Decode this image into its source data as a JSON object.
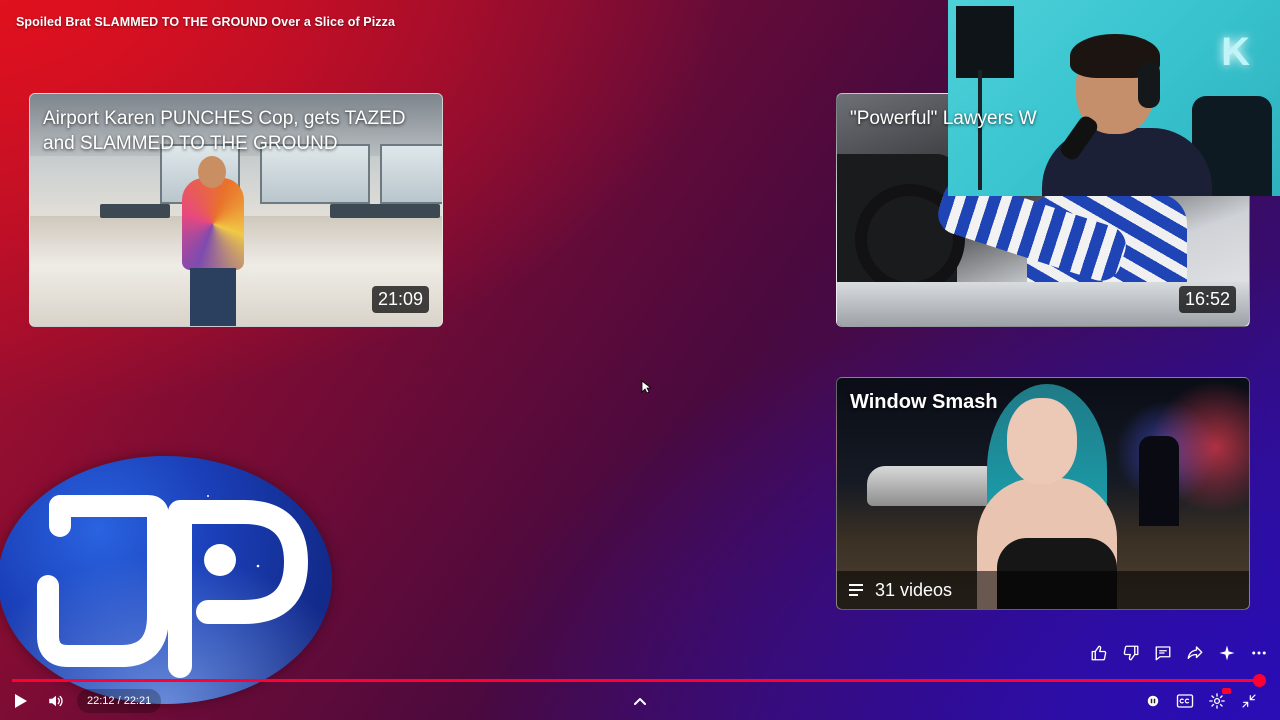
{
  "video": {
    "title": "Spoiled Brat SLAMMED TO THE GROUND Over a Slice of Pizza"
  },
  "end_screen": {
    "cards": [
      {
        "title": "Airport Karen PUNCHES Cop, gets TAZED and SLAMMED TO THE GROUND",
        "duration": "21:09"
      },
      {
        "title": "\"Powerful\" Lawyers W",
        "duration": "16:52"
      },
      {
        "title": "Window Smash",
        "playlist_count": "31 videos"
      }
    ]
  },
  "webcam": {
    "letter": "K"
  },
  "player": {
    "time_display": "22:12 / 22:21",
    "progress_fraction": 0.993,
    "progress_color": "#ff0033"
  },
  "icons": {
    "play": "play-icon",
    "volume": "volume-icon",
    "expand": "chevron-up-icon",
    "like": "thumbs-up-icon",
    "dislike": "thumbs-down-icon",
    "comment": "comment-icon",
    "share": "share-icon",
    "ask": "sparkle-icon",
    "more": "more-icon",
    "autoplay": "autoplay-toggle-icon",
    "captions": "captions-icon",
    "settings": "gear-icon",
    "exit_fullscreen": "exit-fullscreen-icon"
  }
}
